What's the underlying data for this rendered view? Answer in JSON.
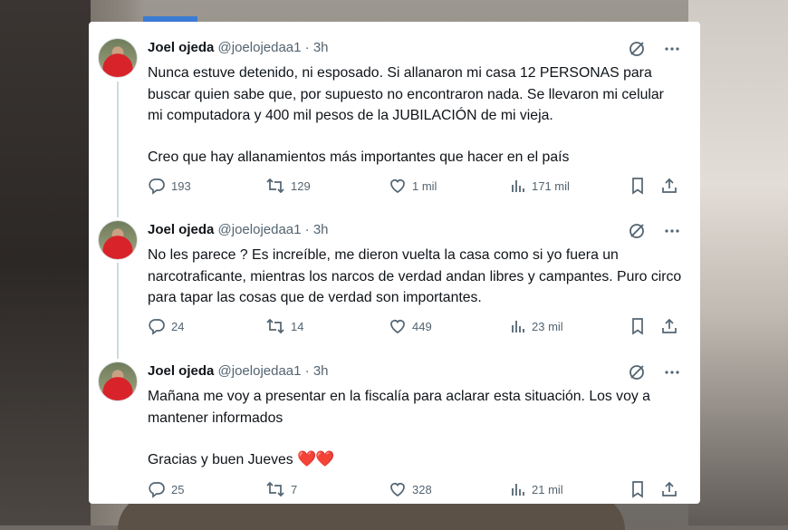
{
  "tweets": [
    {
      "name": "Joel ojeda",
      "handle": "@joelojedaa1",
      "sep": "·",
      "time": "3h",
      "paragraphs": [
        "Nunca estuve detenido, ni esposado. Si allanaron mi casa 12 PERSONAS para buscar quien sabe que, por supuesto no encontraron nada. Se llevaron mi celular mi computadora y 400 mil pesos de la JUBILACIÓN de mi vieja.",
        "Creo que hay allanamientos más importantes que hacer en el país"
      ],
      "replies": "193",
      "retweets": "129",
      "likes": "1 mil",
      "views": "171 mil"
    },
    {
      "name": "Joel ojeda",
      "handle": "@joelojedaa1",
      "sep": "·",
      "time": "3h",
      "paragraphs": [
        "No les parece ? Es increíble, me dieron vuelta la casa como si yo fuera un narcotraficante, mientras los narcos de verdad andan libres y campantes. Puro circo para tapar las cosas que de verdad son importantes."
      ],
      "replies": "24",
      "retweets": "14",
      "likes": "449",
      "views": "23 mil"
    },
    {
      "name": "Joel ojeda",
      "handle": "@joelojedaa1",
      "sep": "·",
      "time": "3h",
      "paragraphs": [
        "Mañana me voy a presentar en la fiscalía para aclarar esta situación. Los voy a mantener informados",
        "Gracias y buen Jueves"
      ],
      "emoji": "❤️❤️",
      "replies": "25",
      "retweets": "7",
      "likes": "328",
      "views": "21 mil"
    }
  ],
  "colors": {
    "text": "#0f1419",
    "secondary": "#536471",
    "heart": "#e0243a",
    "thread_line": "#cfd9de"
  },
  "icons": [
    "grok-icon",
    "more-icon",
    "reply-icon",
    "retweet-icon",
    "like-icon",
    "views-icon",
    "bookmark-icon",
    "share-icon"
  ]
}
